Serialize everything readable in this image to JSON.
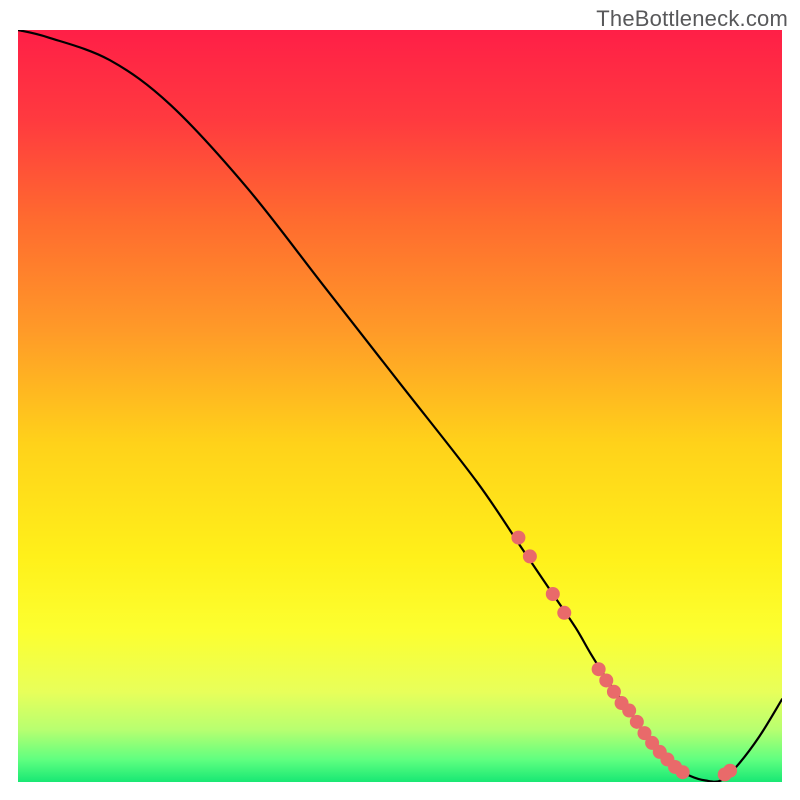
{
  "watermark": "TheBottleneck.com",
  "gradient_stops": [
    {
      "offset": 0.0,
      "color": "#ff1f47"
    },
    {
      "offset": 0.12,
      "color": "#ff3a3f"
    },
    {
      "offset": 0.25,
      "color": "#ff6a2f"
    },
    {
      "offset": 0.4,
      "color": "#ff9a28"
    },
    {
      "offset": 0.55,
      "color": "#ffd21a"
    },
    {
      "offset": 0.7,
      "color": "#fff01a"
    },
    {
      "offset": 0.8,
      "color": "#fcff30"
    },
    {
      "offset": 0.88,
      "color": "#e8ff5a"
    },
    {
      "offset": 0.93,
      "color": "#b8ff70"
    },
    {
      "offset": 0.97,
      "color": "#60ff80"
    },
    {
      "offset": 1.0,
      "color": "#18e874"
    }
  ],
  "marker_color": "#e96a6a",
  "chart_data": {
    "type": "line",
    "title": "",
    "xlabel": "",
    "ylabel": "",
    "xlim": [
      0,
      100
    ],
    "ylim": [
      0,
      100
    ],
    "series": [
      {
        "name": "curve",
        "x": [
          0,
          4,
          12,
          20,
          30,
          40,
          50,
          60,
          66,
          70,
          73,
          75,
          77.5,
          80,
          82,
          84,
          86,
          88,
          90,
          92,
          94,
          97,
          100
        ],
        "values": [
          100,
          99,
          96,
          90,
          79,
          66,
          53,
          40,
          31,
          25,
          20.5,
          17,
          13,
          9.5,
          6.5,
          4,
          2,
          0.8,
          0.2,
          0.2,
          2,
          6,
          11
        ]
      }
    ],
    "markers": [
      {
        "x": 65.5,
        "y": 32.5
      },
      {
        "x": 67.0,
        "y": 30.0
      },
      {
        "x": 70.0,
        "y": 25.0
      },
      {
        "x": 71.5,
        "y": 22.5
      },
      {
        "x": 76.0,
        "y": 15.0
      },
      {
        "x": 77.0,
        "y": 13.5
      },
      {
        "x": 78.0,
        "y": 12.0
      },
      {
        "x": 79.0,
        "y": 10.5
      },
      {
        "x": 80.0,
        "y": 9.5
      },
      {
        "x": 81.0,
        "y": 8.0
      },
      {
        "x": 82.0,
        "y": 6.5
      },
      {
        "x": 83.0,
        "y": 5.2
      },
      {
        "x": 84.0,
        "y": 4.0
      },
      {
        "x": 85.0,
        "y": 3.0
      },
      {
        "x": 86.0,
        "y": 2.0
      },
      {
        "x": 87.0,
        "y": 1.3
      },
      {
        "x": 92.5,
        "y": 1.0
      },
      {
        "x": 93.2,
        "y": 1.5
      }
    ]
  }
}
